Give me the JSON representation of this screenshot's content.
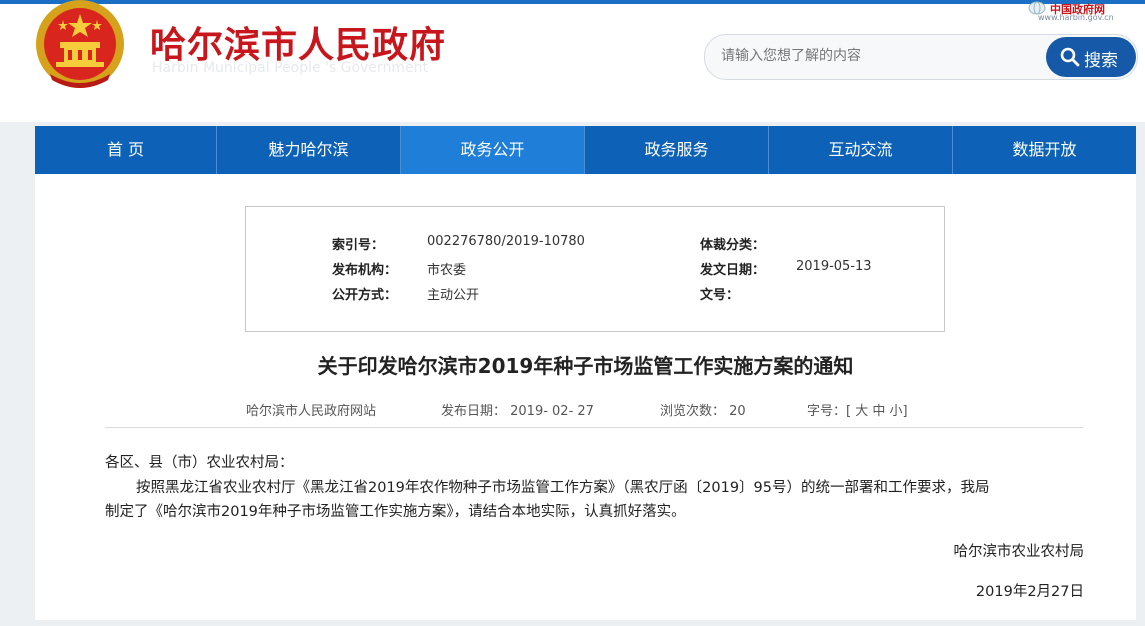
{
  "header": {
    "title": "哈尔滨市人民政府",
    "subtitle": "Harbin Municipal People 's Government",
    "corner_badge": "中国政府网",
    "corner_url": "www.harbin.gov.cn"
  },
  "search": {
    "placeholder": "请输入您想了解的内容",
    "button_label": "搜索"
  },
  "nav": {
    "items": [
      {
        "label": "首 页"
      },
      {
        "label": "魅力哈尔滨"
      },
      {
        "label": "政务公开"
      },
      {
        "label": "政务服务"
      },
      {
        "label": "互动交流"
      },
      {
        "label": "数据开放"
      }
    ],
    "active_index": 2
  },
  "meta": {
    "index_label": "索引号：",
    "index_value": "002276780/2019-10780",
    "genre_label": "体裁分类：",
    "genre_value": "",
    "publisher_label": "发布机构：",
    "publisher_value": "市农委",
    "issue_date_label": "发文日期：",
    "issue_date_value": "2019-05-13",
    "mode_label": "公开方式：",
    "mode_value": "主动公开",
    "doc_no_label": "文号：",
    "doc_no_value": ""
  },
  "article": {
    "title": "关于印发哈尔滨市2019年种子市场监管工作实施方案的通知",
    "source": "哈尔滨市人民政府网站",
    "publish_date": "发布日期： 2019- 02- 27",
    "views": "浏览次数： 20",
    "font_size_label": "字号：[",
    "font_large": "大",
    "font_medium": "中",
    "font_small": "小",
    "font_size_end": "]",
    "salutation": "各区、县（市）农业农村局：",
    "para1_line1": "按照黑龙江省农业农村厅《黑龙江省2019年农作物种子市场监管工作方案》（黑农厅函〔2019〕95号）的统一部署和工作要求，我局",
    "para1_line2": "制定了《哈尔滨市2019年种子市场监管工作实施方案》，请结合本地实际，认真抓好落实。",
    "signature": "哈尔滨市农业农村局",
    "sign_date": "2019年2月27日"
  },
  "colors": {
    "brand_red": "#c8161d",
    "nav_blue": "#0d62b8",
    "nav_active": "#1e7ed8",
    "search_button": "#1559a8"
  }
}
